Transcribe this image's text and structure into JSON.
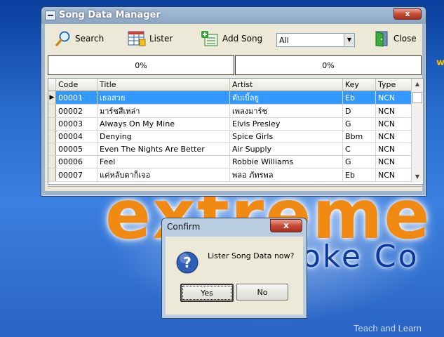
{
  "background": {
    "big_text": "extreme",
    "sub_text": "oke Co",
    "edge_letter": "w",
    "watermark": "Teach and Learn"
  },
  "window": {
    "title": "Song Data Manager",
    "close_glyph": "x",
    "toolbar": {
      "search_label": "Search",
      "lister_label": "Lister",
      "add_song_label": "Add Song",
      "filter_value": "All",
      "close_label": "Close"
    },
    "progress": {
      "left_text": "0%",
      "right_text": "0%",
      "left_value": 0,
      "right_value": 0
    },
    "table": {
      "columns": [
        "Code",
        "Title",
        "Artist",
        "Key",
        "Type"
      ],
      "rows": [
        [
          "00001",
          "เธอสวย",
          "ดับเบิ้ลยู",
          "Eb",
          "NCN"
        ],
        [
          "00002",
          "มาร์ชสีเหล่า",
          "เพลงมาร์ช",
          "D",
          "NCN"
        ],
        [
          "00003",
          "Always On My Mine",
          "Elvis Presley",
          "G",
          "NCN"
        ],
        [
          "00004",
          "Denying",
          "Spice Girls",
          "Bbm",
          "NCN"
        ],
        [
          "00005",
          "Even The Nights Are Better",
          "Air Supply",
          "C",
          "NCN"
        ],
        [
          "00006",
          "Feel",
          "Robbie Williams",
          "G",
          "NCN"
        ],
        [
          "00007",
          "แค่หลับตาก็เจอ",
          "พลอ ภัทรพล",
          "Eb",
          "NCN"
        ]
      ],
      "selected_row": 0
    }
  },
  "dialog": {
    "title": "Confirm",
    "close_glyph": "x",
    "message": "Lister Song Data now?",
    "yes_label": "Yes",
    "no_label": "No"
  },
  "colors": {
    "selection": "#3399ff",
    "logo_orange": "#f08a12",
    "title_blue": "#0b3a9a"
  }
}
